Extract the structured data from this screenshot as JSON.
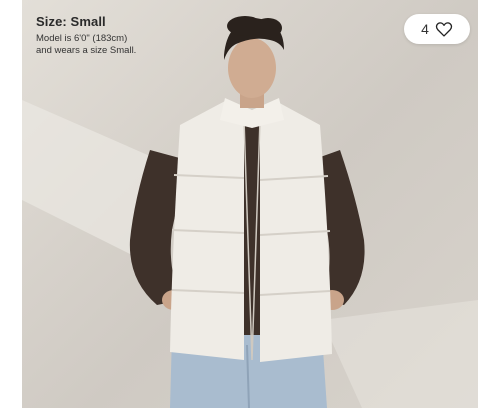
{
  "product": {
    "size_title": "Size: Small",
    "model_info_line1": "Model is 6'0\" (183cm)",
    "model_info_line2": "and wears a size Small.",
    "favorites_count": "4"
  },
  "icons": {
    "favorite": "heart-outline-icon"
  },
  "colors": {
    "background_wall": "#d8d3cc",
    "vest": "#efece6",
    "sweater": "#3e312a",
    "jeans": "#a9bccf",
    "text": "#2a2a2a"
  }
}
